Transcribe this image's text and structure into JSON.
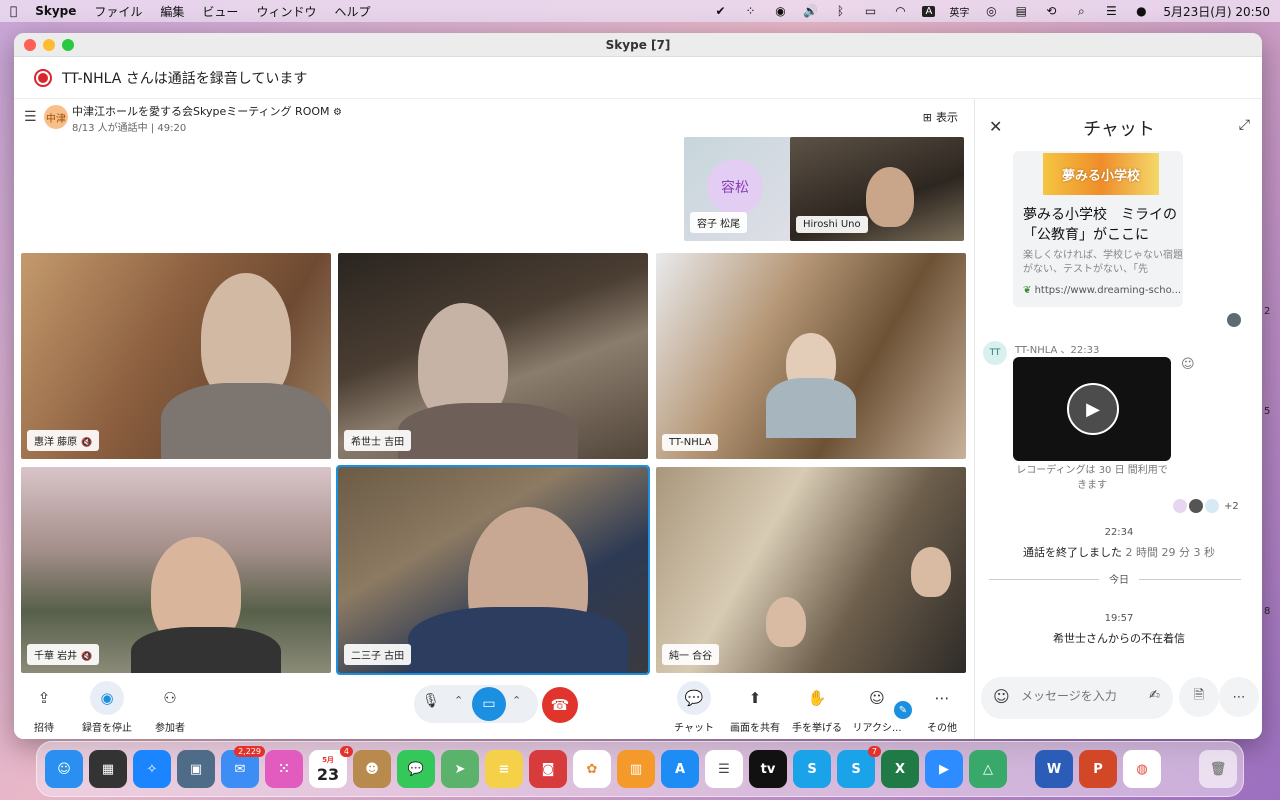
{
  "menubar": {
    "app": "Skype",
    "items": [
      "ファイル",
      "編集",
      "ビュー",
      "ウィンドウ",
      "ヘルプ"
    ],
    "ime": "A",
    "ime_label": "英字",
    "clock": "5月23日(月)  20:50"
  },
  "window": {
    "title": "Skype [7]",
    "recording_banner": "TT-NHLA さんは通話を録音しています"
  },
  "call": {
    "group_avatar": "中津",
    "group_name": "中津江ホールを愛する会Skypeミーティング ROOM",
    "status": "8/13 人が通話中 | 49:20",
    "view_label": "表示",
    "thumbnails": [
      {
        "name": "容子 松尾",
        "initials": "容松"
      },
      {
        "name": "Hiroshi Uno"
      }
    ],
    "tiles": [
      {
        "name": "惠洋 藤原",
        "muted": true
      },
      {
        "name": "希世士 吉田",
        "muted": false
      },
      {
        "name": "TT-NHLA",
        "muted": false
      },
      {
        "name": "千華 岩井",
        "muted": true
      },
      {
        "name": "二三子 古田",
        "muted": false
      },
      {
        "name": "純一 合谷",
        "muted": false
      }
    ],
    "mic_off_glyph": "🔇"
  },
  "toolbar": {
    "invite": "招待",
    "stop_recording": "録音を停止",
    "participants": "参加者",
    "chat": "チャット",
    "share_screen": "画面を共有",
    "raise_hand": "手を挙げる",
    "reactions": "リアクシ...",
    "more": "その他"
  },
  "chat": {
    "title": "チャット",
    "link_card": {
      "banner": "夢みる小学校",
      "title": "夢みる小学校　ミライの「公教育」がここに",
      "description": "楽しくなければ、学校じゃない宿題がない、テストがない、「先",
      "url": "https://www.dreaming-scho..."
    },
    "message": {
      "avatar": "TT",
      "meta": "TT-NHLA 、22:33",
      "recording_note": "レコーディングは 30 日 間利用できます",
      "readers_more": "+2"
    },
    "time1": "22:34",
    "call_ended": "通話を終了しました",
    "call_duration": "2 時間 29 分 3 秒",
    "today": "今日",
    "time2": "19:57",
    "missed_call": "希世士さんからの不在着信",
    "input_placeholder": "メッセージを入力"
  },
  "dock": {
    "mail_badge": "2,229",
    "calendar_month": "5月",
    "calendar_day": "23",
    "calendar_badge": "4",
    "skype_badge": "7"
  },
  "colors": {
    "accent": "#1b8fe0",
    "record": "#d9262c",
    "hangup": "#e0342d"
  }
}
